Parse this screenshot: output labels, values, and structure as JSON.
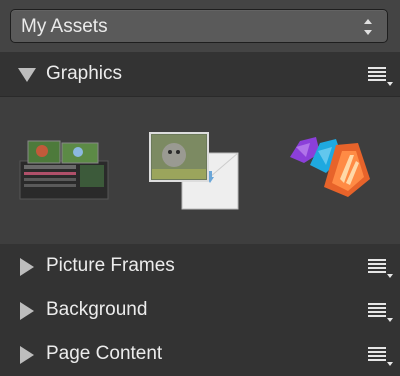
{
  "assets_dropdown": {
    "selected": "My Assets"
  },
  "categories": [
    {
      "title": "Graphics",
      "expanded": true
    },
    {
      "title": "Picture Frames",
      "expanded": false
    },
    {
      "title": "Background",
      "expanded": false
    },
    {
      "title": "Page Content",
      "expanded": false
    }
  ],
  "graphics_items": [
    "screenshot-thumbnail",
    "photo-envelope-thumbnail",
    "affinity-apps-logo-thumbnail"
  ],
  "colors": {
    "panel": "#3a3a3a",
    "header": "#333333",
    "accent_purple": "#8b3fd9",
    "accent_blue": "#1fa9e0",
    "accent_orange": "#e7632a"
  }
}
